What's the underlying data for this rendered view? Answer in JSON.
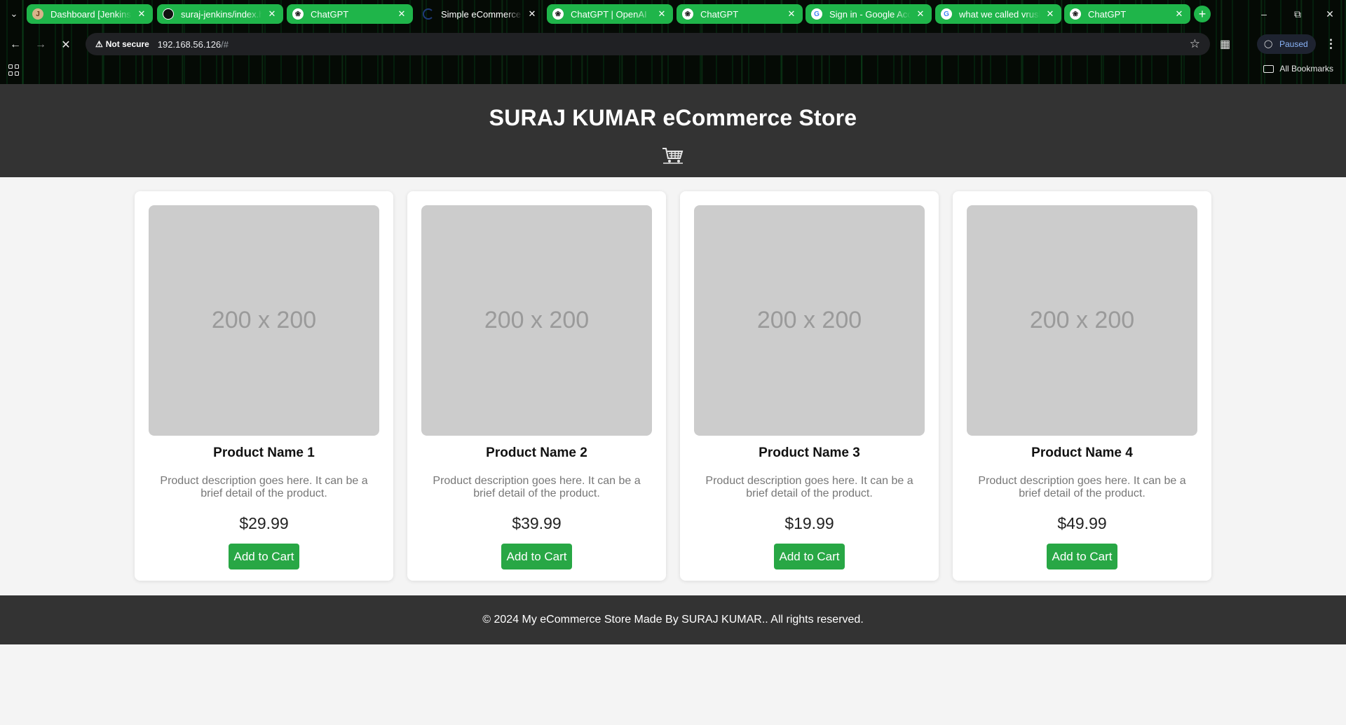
{
  "browser": {
    "tabs": [
      {
        "title": "Dashboard [Jenkins]",
        "favicon": "jenkins-icon",
        "active": false
      },
      {
        "title": "suraj-jenkins/index.html",
        "favicon": "github-icon",
        "active": false
      },
      {
        "title": "ChatGPT",
        "favicon": "openai-icon",
        "active": false
      },
      {
        "title": "Simple eCommerce Page",
        "favicon": "loading-icon",
        "active": true
      },
      {
        "title": "ChatGPT | OpenAI",
        "favicon": "openai-icon",
        "active": false
      },
      {
        "title": "ChatGPT",
        "favicon": "openai-icon",
        "active": false
      },
      {
        "title": "Sign in - Google Accounts",
        "favicon": "google-icon",
        "active": false
      },
      {
        "title": "what we called vrushabh",
        "favicon": "google-icon",
        "active": false
      },
      {
        "title": "ChatGPT",
        "favicon": "openai-icon",
        "active": false
      }
    ],
    "security_label": "Not secure",
    "url_host": "192.168.56.126",
    "url_rest": "/#",
    "profile_status": "Paused",
    "bookmarks_label": "All Bookmarks",
    "tab_accent_color": "#1fb54a"
  },
  "header": {
    "title": "SURAJ KUMAR eCommerce Store",
    "cart_icon": "shopping-cart-icon"
  },
  "products": [
    {
      "name": "Product Name 1",
      "image_text": "200 x 200",
      "description": "Product description goes here. It can be a brief detail of the product.",
      "price": "$29.99",
      "button": "Add to Cart"
    },
    {
      "name": "Product Name 2",
      "image_text": "200 x 200",
      "description": "Product description goes here. It can be a brief detail of the product.",
      "price": "$39.99",
      "button": "Add to Cart"
    },
    {
      "name": "Product Name 3",
      "image_text": "200 x 200",
      "description": "Product description goes here. It can be a brief detail of the product.",
      "price": "$19.99",
      "button": "Add to Cart"
    },
    {
      "name": "Product Name 4",
      "image_text": "200 x 200",
      "description": "Product description goes here. It can be a brief detail of the product.",
      "price": "$49.99",
      "button": "Add to Cart"
    }
  ],
  "footer": {
    "text": "© 2024 My eCommerce Store Made By SURAJ KUMAR.. All rights reserved."
  },
  "colors": {
    "header_bg": "#333333",
    "button_green": "#28a745",
    "page_bg": "#f4f4f4"
  }
}
